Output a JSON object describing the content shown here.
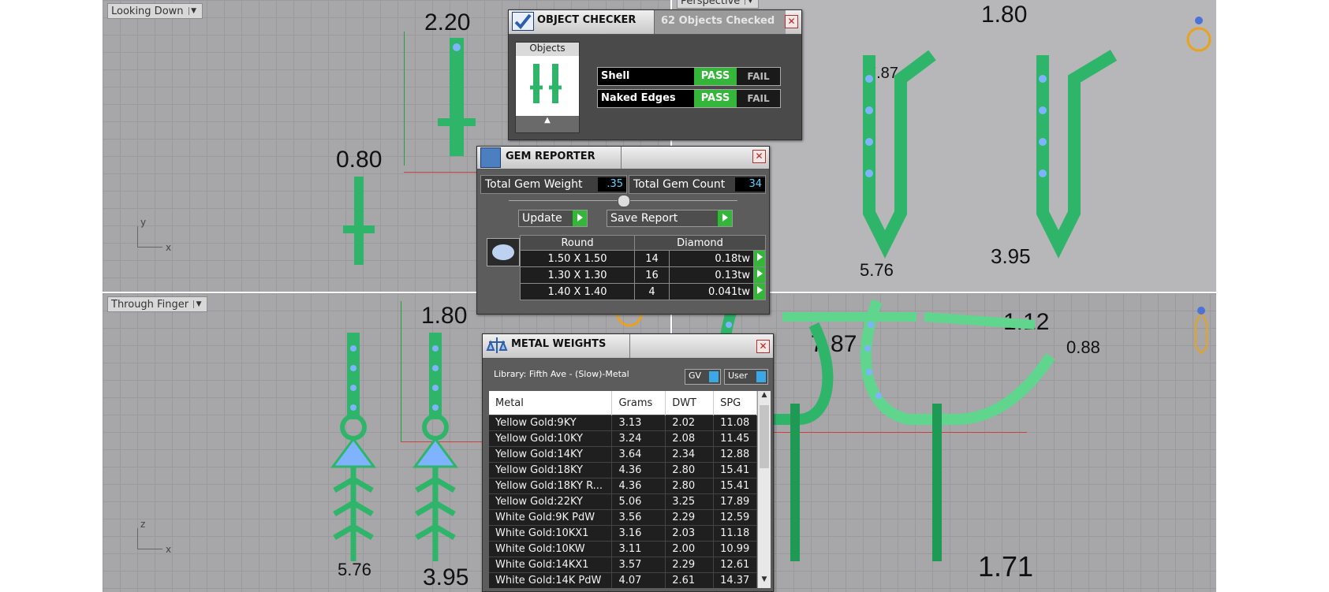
{
  "viewports": {
    "top_left": {
      "label": "Looking Down"
    },
    "top_right": {
      "label": "Perspective"
    },
    "bottom_left": {
      "label": "Through Finger"
    }
  },
  "dimensions": {
    "d220": "2.20",
    "d080": "0.80",
    "d180_tr": "1.80",
    "d787_tr": "7.87",
    "d576_tr": "5.76",
    "d395_tr": "3.95",
    "d180_bl": "1.80",
    "d576_bl": "5.76",
    "d395_bl": "3.95",
    "d787_br": "7.87",
    "d112_br": "1.12",
    "d088_br": "0.88",
    "d171_br": "1.71"
  },
  "axes": {
    "y": "y",
    "x": "x",
    "z": "z"
  },
  "object_checker": {
    "title": "OBJECT CHECKER",
    "checked": "62  Objects Checked",
    "objects_header": "Objects",
    "rows": [
      {
        "label": "Shell",
        "pass": "PASS",
        "fail": "FAIL"
      },
      {
        "label": "Naked Edges",
        "pass": "PASS",
        "fail": "FAIL"
      }
    ]
  },
  "gem_reporter": {
    "title": "GEM REPORTER",
    "total_weight_label": "Total Gem Weight",
    "total_weight": ".35",
    "total_count_label": "Total Gem Count",
    "total_count": "34",
    "update_label": "Update",
    "save_label": "Save Report",
    "table_headers": [
      "Round",
      "Diamond"
    ],
    "rows": [
      {
        "size": "1.50 X 1.50",
        "count": "14",
        "tw": "0.18tw"
      },
      {
        "size": "1.30 X 1.30",
        "count": "16",
        "tw": "0.13tw"
      },
      {
        "size": "1.40 X 1.40",
        "count": "4",
        "tw": "0.041tw"
      }
    ]
  },
  "metal_weights": {
    "title": "METAL WEIGHTS",
    "library": "Library: Fifth Ave - (Slow)-Metal",
    "gv": "GV",
    "user": "User",
    "headers": [
      "Metal",
      "Grams",
      "DWT",
      "SPG"
    ],
    "rows": [
      [
        "Yellow Gold:9KY",
        "3.13",
        "2.02",
        "11.08"
      ],
      [
        "Yellow Gold:10KY",
        "3.24",
        "2.08",
        "11.45"
      ],
      [
        "Yellow Gold:14KY",
        "3.64",
        "2.34",
        "12.88"
      ],
      [
        "Yellow Gold:18KY",
        "4.36",
        "2.80",
        "15.41"
      ],
      [
        "Yellow Gold:18KY R...",
        "4.36",
        "2.80",
        "15.41"
      ],
      [
        "Yellow Gold:22KY",
        "5.06",
        "3.25",
        "17.89"
      ],
      [
        "White Gold:9K PdW",
        "3.56",
        "2.29",
        "12.59"
      ],
      [
        "White Gold:10KX1",
        "3.16",
        "2.03",
        "11.18"
      ],
      [
        "White Gold:10KW",
        "3.11",
        "2.00",
        "10.99"
      ],
      [
        "White Gold:14KX1",
        "3.57",
        "2.29",
        "12.61"
      ],
      [
        "White Gold:14K PdW",
        "4.07",
        "2.61",
        "14.37"
      ]
    ]
  },
  "colors": {
    "model": "#2fb56a",
    "model_light": "#5fd58e",
    "gem": "#7fb3ff",
    "pass": "#35b53a"
  }
}
